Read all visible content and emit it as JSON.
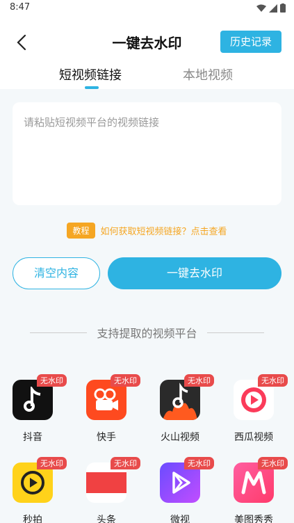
{
  "status": {
    "time": "8:47"
  },
  "header": {
    "title": "一键去水印",
    "history_label": "历史记录"
  },
  "tabs": [
    {
      "label": "短视频链接"
    },
    {
      "label": "本地视频"
    }
  ],
  "input": {
    "placeholder": "请粘贴短视频平台的视频链接",
    "value": ""
  },
  "tutorial": {
    "badge": "教程",
    "link": "如何获取短视频链接？点击查看"
  },
  "buttons": {
    "clear": "清空内容",
    "remove": "一键去水印"
  },
  "section": {
    "title": "支持提取的视频平台"
  },
  "accent_color": "#2eb3e2",
  "platforms": [
    {
      "name": "抖音",
      "badge": "无水印",
      "icon": "douyin-icon"
    },
    {
      "name": "快手",
      "badge": "无水印",
      "icon": "kuaishou-icon"
    },
    {
      "name": "火山视频",
      "badge": "无水印",
      "icon": "huoshan-icon"
    },
    {
      "name": "西瓜视频",
      "badge": "无水印",
      "icon": "xigua-icon"
    },
    {
      "name": "秒拍",
      "badge": "无水印",
      "icon": "miaopai-icon"
    },
    {
      "name": "头条",
      "badge": "无水印",
      "icon": "toutiao-icon"
    },
    {
      "name": "微视",
      "badge": "无水印",
      "icon": "weishi-icon"
    },
    {
      "name": "美图秀秀",
      "badge": "无水印",
      "icon": "meitu-icon"
    }
  ]
}
